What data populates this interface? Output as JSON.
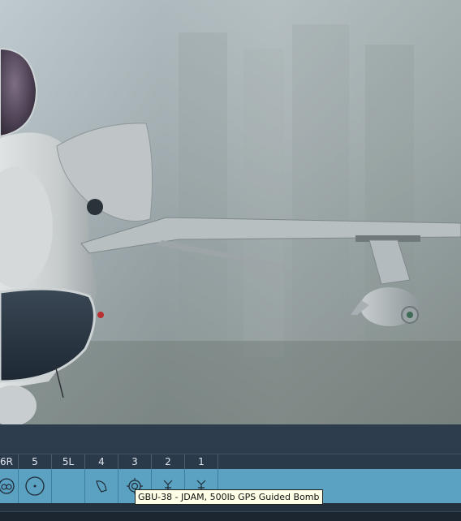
{
  "stations": [
    {
      "label": "6R",
      "icon": "pylon-round-store-icon"
    },
    {
      "label": "5",
      "icon": "fuel-tank-icon"
    },
    {
      "label": "5L",
      "icon": "empty-station"
    },
    {
      "label": "4",
      "icon": "pod-store-icon"
    },
    {
      "label": "3",
      "icon": "guided-bomb-icon"
    },
    {
      "label": "2",
      "icon": "missile-rack-icon"
    },
    {
      "label": "1",
      "icon": "missile-rack-icon"
    }
  ],
  "tooltip": {
    "text": "GBU-38 - JDAM, 500lb GPS Guided Bomb"
  },
  "colors": {
    "panel_dark": "#2a3a4b",
    "station_row": "#5ba1c2",
    "tooltip_bg": "#fffee6"
  }
}
